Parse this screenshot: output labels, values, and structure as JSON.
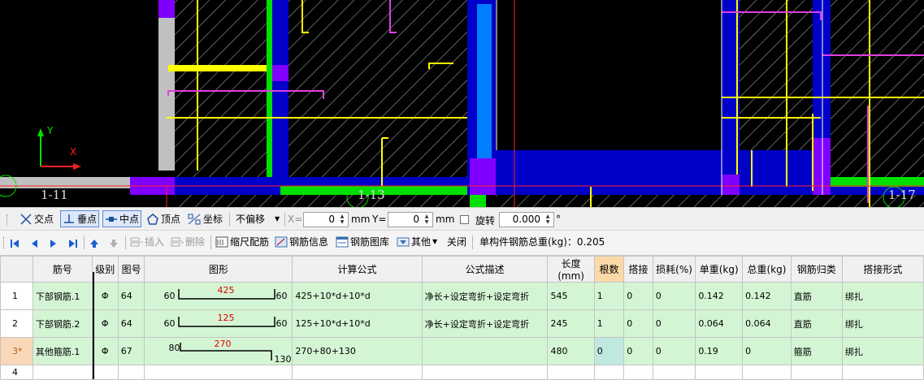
{
  "canvas": {
    "axis_y_label": "Y",
    "axis_x_label": "X",
    "grid_labels": [
      "1-11",
      "1-13",
      "1-17"
    ],
    "colors": {
      "background": "#000000",
      "blue": "#0000c8",
      "purple": "#8000ff",
      "green": "#00e000",
      "yellow": "#ffff00",
      "magenta": "#e040e0",
      "cyan": "#0080ff",
      "gray": "#c0c0c0",
      "red": "#ff2020"
    }
  },
  "snapbar": {
    "intersection": "交点",
    "perpendicular": "垂点",
    "midpoint": "中点",
    "vertex": "顶点",
    "coordinate": "坐标",
    "offset_select": "不偏移",
    "x_label": "X=",
    "x_value": "0",
    "x_unit": "mm",
    "y_label": "Y=",
    "y_value": "0",
    "y_unit": "mm",
    "rotate_label": "旋转",
    "rotate_value": "0.000",
    "rotate_unit": "°"
  },
  "navbar": {
    "insert": "插入",
    "delete": "删除",
    "scale_rebar": "缩尺配筋",
    "rebar_info": "钢筋信息",
    "rebar_library": "钢筋图库",
    "other": "其他",
    "close": "关闭",
    "total_weight_label": "单构件钢筋总重(kg)：0.205"
  },
  "table": {
    "columns": [
      "",
      "筋号",
      "级别",
      "图号",
      "图形",
      "计算公式",
      "公式描述",
      "长度(mm)",
      "根数",
      "搭接",
      "损耗(%)",
      "单重(kg)",
      "总重(kg)",
      "钢筋归类",
      "搭接形式"
    ],
    "rows": [
      {
        "rn": "1",
        "name": "下部钢筋.1",
        "grade": "Φ",
        "fig": "64",
        "shape": {
          "left": "60",
          "mid": "425",
          "right": "60"
        },
        "formula": "425+10*d+10*d",
        "desc": "净长+设定弯折+设定弯折",
        "length": "545",
        "count": "1",
        "lap": "0",
        "loss": "0",
        "unit_w": "0.142",
        "total_w": "0.142",
        "category": "直筋",
        "lap_type": "绑扎"
      },
      {
        "rn": "2",
        "name": "下部钢筋.2",
        "grade": "Φ",
        "fig": "64",
        "shape": {
          "left": "60",
          "mid": "125",
          "right": "60"
        },
        "formula": "125+10*d+10*d",
        "desc": "净长+设定弯折+设定弯折",
        "length": "245",
        "count": "1",
        "lap": "0",
        "loss": "0",
        "unit_w": "0.064",
        "total_w": "0.064",
        "category": "直筋",
        "lap_type": "绑扎"
      },
      {
        "rn": "3*",
        "name": "其他箍筋.1",
        "grade": "Φ",
        "fig": "67",
        "shape": {
          "left": "80",
          "mid": "270",
          "right": "130"
        },
        "formula": "270+80+130",
        "desc": "",
        "length": "480",
        "count": "0",
        "lap": "0",
        "loss": "0",
        "unit_w": "0.19",
        "total_w": "0",
        "category": "箍筋",
        "lap_type": "绑扎"
      },
      {
        "rn": "4",
        "name": "",
        "grade": "",
        "fig": "",
        "shape": {
          "left": "",
          "mid": "",
          "right": ""
        },
        "formula": "",
        "desc": "",
        "length": "",
        "count": "",
        "lap": "",
        "loss": "",
        "unit_w": "",
        "total_w": "",
        "category": "",
        "lap_type": ""
      }
    ]
  }
}
